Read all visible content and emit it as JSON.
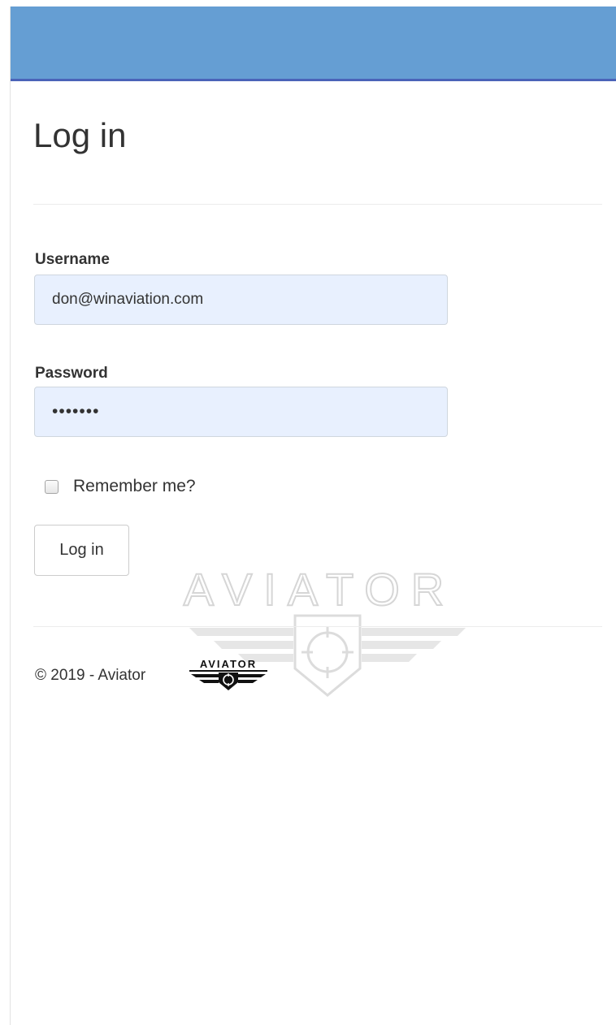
{
  "header": {
    "bar_color": "#659ed3",
    "bar_border_color": "#4a63b8"
  },
  "page": {
    "title": "Log in"
  },
  "form": {
    "username_label": "Username",
    "username_value": "don@winaviation.com",
    "password_label": "Password",
    "password_value": "•••••••",
    "remember_label": "Remember me?",
    "remember_checked": false,
    "submit_label": "Log in"
  },
  "watermark": {
    "text": "AVIATOR",
    "icon": "crosshair-wings-icon"
  },
  "footer": {
    "copyright": "© 2019 - Aviator",
    "logo_text": "AVIATOR",
    "logo_icon": "aviator-logo-icon"
  },
  "colors": {
    "input_background": "#e8f0fe",
    "text": "#333333"
  }
}
